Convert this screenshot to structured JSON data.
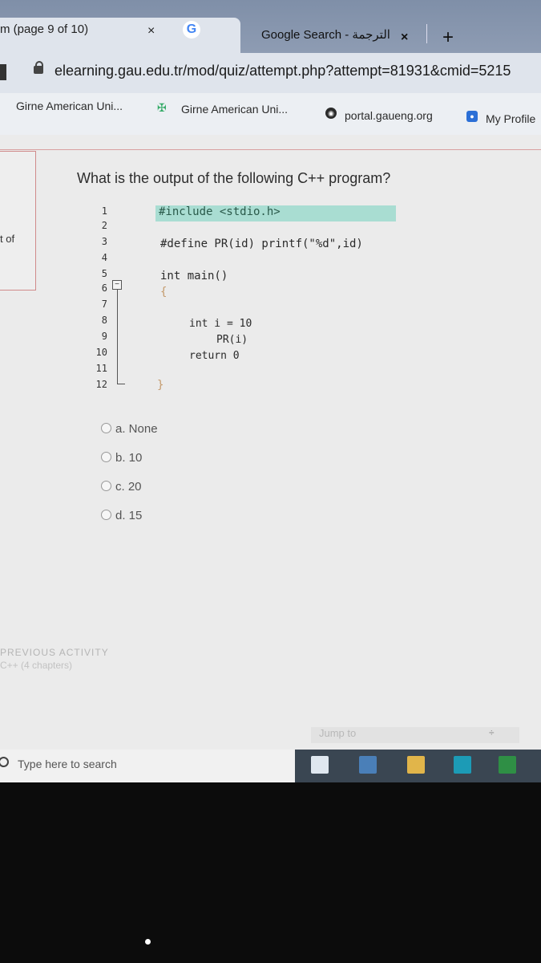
{
  "browser": {
    "tab_active_title": "m (page 9 of 10)",
    "tab_active_close": "×",
    "tab_second_icon": "G",
    "tab_second_title": "Google Search - الترجمة",
    "tab_second_close": "×",
    "new_tab": "+",
    "url": "elearning.gau.edu.tr/mod/quiz/attempt.php?attempt=81931&cmid=5215",
    "bookmarks": [
      {
        "label": "Girne American Uni...",
        "icon": ""
      },
      {
        "label": "Girne American Uni...",
        "icon": "crest-icon"
      },
      {
        "label": "portal.gaueng.org",
        "icon": "globe-icon"
      },
      {
        "label": "My Profile",
        "icon": "profile-icon"
      }
    ]
  },
  "sidebar": {
    "fragment_text": "t of"
  },
  "question": {
    "text": "What is the output of the following C++ program?",
    "line_numbers": [
      "1",
      "2",
      "3",
      "4",
      "5",
      "6",
      "7",
      "8",
      "9",
      "10",
      "11",
      "12"
    ],
    "code": {
      "line1": "#include <stdio.h>",
      "line3": "#define PR(id)  printf(\"%d\",id)",
      "line5": "int main()",
      "line6": "{",
      "line8": "int i = 10",
      "line9": "PR(i)",
      "line10": "return 0",
      "line12": "}"
    },
    "options": [
      "a. None",
      "b. 10",
      "c. 20",
      "d. 15"
    ]
  },
  "footer": {
    "previous_activity": "PREVIOUS ACTIVITY",
    "previous_activity_sub": "C++ (4 chapters)",
    "jump_to": "Jump to",
    "jump_arrow": "÷"
  },
  "taskbar": {
    "search_placeholder": "Type here to search"
  },
  "colors": {
    "code_highlight": "#a9ddd2",
    "tab_bar": "#8e9cb3",
    "taskbar": "#3a4652"
  }
}
